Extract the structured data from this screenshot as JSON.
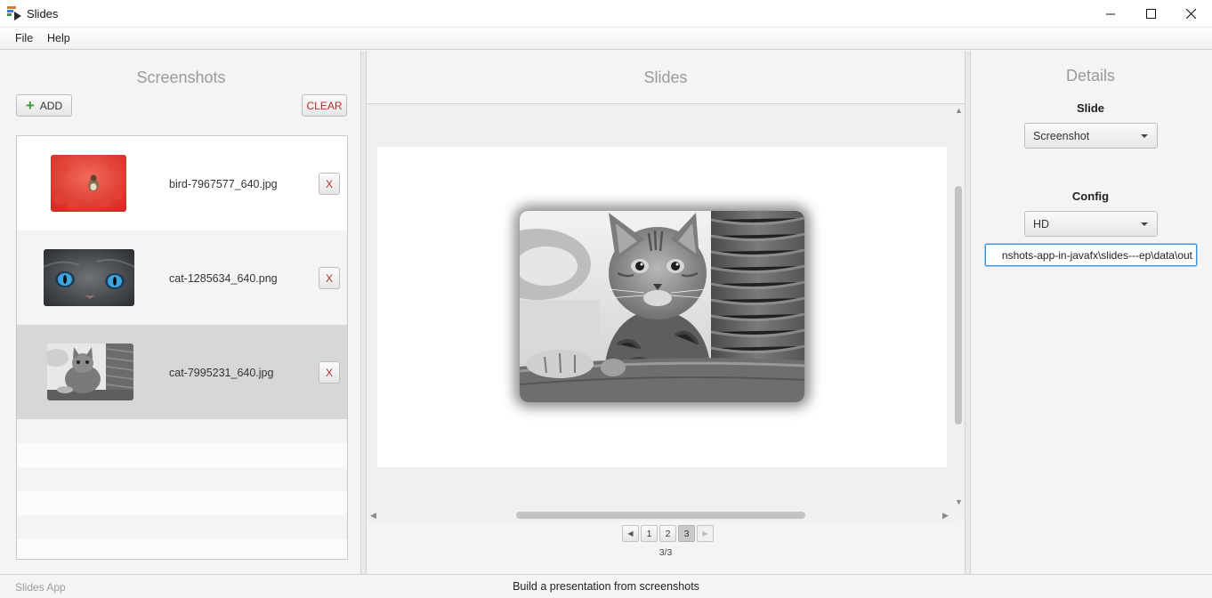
{
  "window": {
    "title": "Slides"
  },
  "menu": {
    "file": "File",
    "help": "Help"
  },
  "screenshots_pane": {
    "title": "Screenshots",
    "add_label": "ADD",
    "clear_label": "CLEAR",
    "remove_label": "X",
    "items": [
      {
        "filename": "bird-7967577_640.jpg",
        "thumb": "bird-on-red-flowers"
      },
      {
        "filename": "cat-1285634_640.png",
        "thumb": "cat-blue-eyes"
      },
      {
        "filename": "cat-7995231_640.jpg",
        "thumb": "tabby-cat-grayscale",
        "selected": true
      }
    ]
  },
  "slides_pane": {
    "title": "Slides",
    "pages": [
      "1",
      "2",
      "3"
    ],
    "current_page": 3,
    "page_info": "3/3"
  },
  "details_pane": {
    "title": "Details",
    "slide_label": "Slide",
    "slide_value": "Screenshot",
    "config_label": "Config",
    "config_value": "HD",
    "output_path": "nshots-app-in-javafx\\slides---ep\\data\\out"
  },
  "status": {
    "app_name": "Slides App",
    "message": "Build a presentation from screenshots"
  },
  "colors": {
    "accent_red": "#b5322c",
    "add_green": "#3c9d3c",
    "focus_blue": "#3a95de"
  }
}
